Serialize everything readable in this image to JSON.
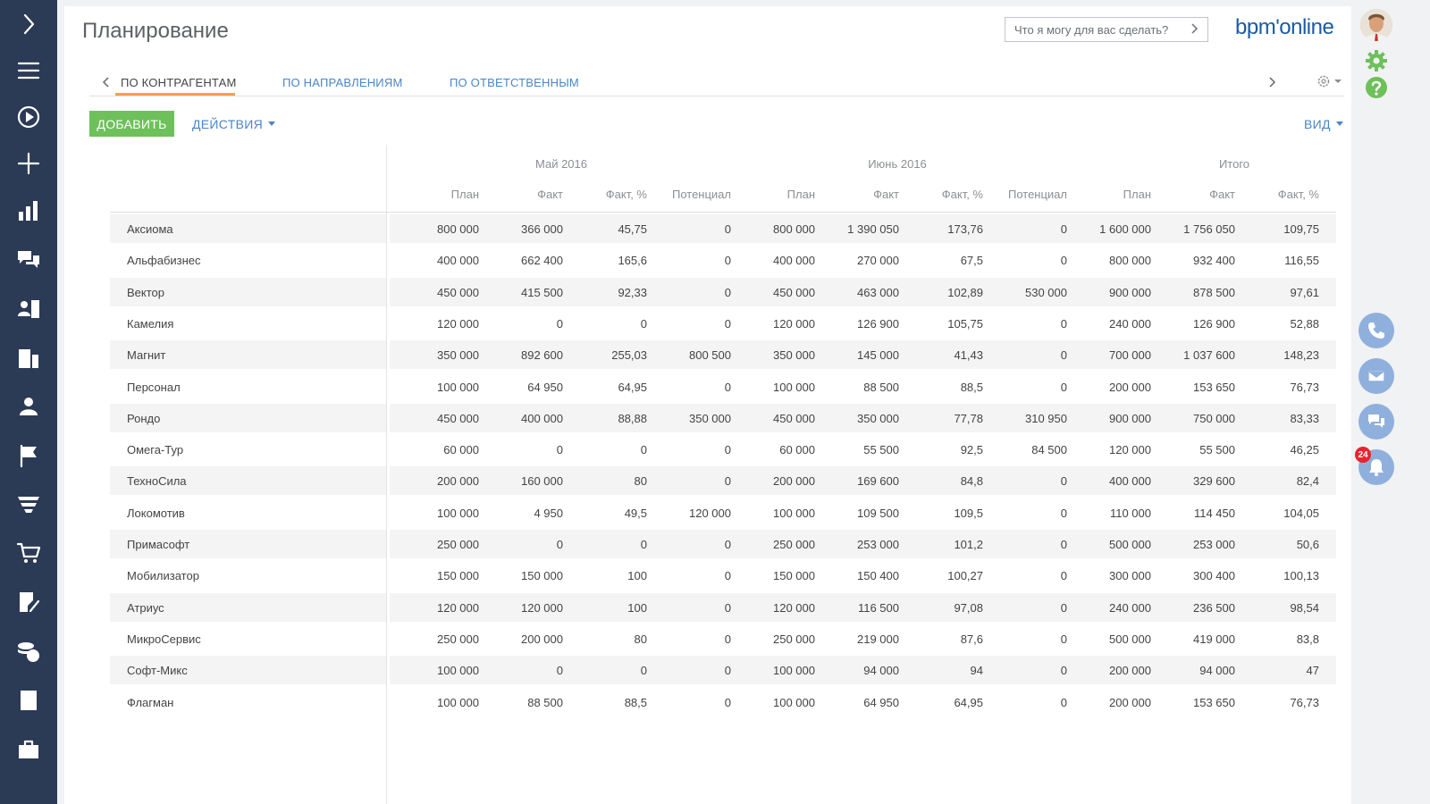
{
  "page": {
    "title": "Планирование",
    "search_placeholder": "Что я могу для вас сделать?",
    "logo_text": "bpm'online"
  },
  "tabs": [
    {
      "label": "ПО КОНТРАГЕНТАМ",
      "active": true
    },
    {
      "label": "ПО НАПРАВЛЕНИЯМ",
      "active": false
    },
    {
      "label": "ПО ОТВЕТСТВЕННЫМ",
      "active": false
    }
  ],
  "toolbar": {
    "add_label": "ДОБАВИТЬ",
    "actions_label": "ДЕЙСТВИЯ",
    "view_label": "ВИД"
  },
  "colors": {
    "sidebar": "#2b3a55",
    "accent_green": "#6ec05b",
    "link_blue": "#4a86c5",
    "tab_underline": "#f2a14e",
    "badge_red": "#e8242f"
  },
  "sidebar_icons": [
    "chevron-right-icon",
    "menu-icon",
    "play-icon",
    "plus-icon",
    "bar-chart-icon",
    "chat-icon",
    "contacts-icon",
    "building-icon",
    "person-icon",
    "flag-icon",
    "funnel-icon",
    "cart-icon",
    "document-edit-icon",
    "coins-icon",
    "document-icon",
    "briefcase-icon"
  ],
  "grid": {
    "periods": [
      "Май 2016",
      "Июнь 2016",
      "Итого"
    ],
    "columns": [
      "План",
      "Факт",
      "Факт, %",
      "Потенциал",
      "План",
      "Факт",
      "Факт, %",
      "Потенциал",
      "План",
      "Факт",
      "Факт, %"
    ],
    "rows": [
      {
        "name": "Аксиома",
        "values": [
          "800 000",
          "366 000",
          "45,75",
          "0",
          "800 000",
          "1 390 050",
          "173,76",
          "0",
          "1 600 000",
          "1 756 050",
          "109,75"
        ]
      },
      {
        "name": "Альфабизнес",
        "values": [
          "400 000",
          "662 400",
          "165,6",
          "0",
          "400 000",
          "270 000",
          "67,5",
          "0",
          "800 000",
          "932 400",
          "116,55"
        ]
      },
      {
        "name": "Вектор",
        "values": [
          "450 000",
          "415 500",
          "92,33",
          "0",
          "450 000",
          "463 000",
          "102,89",
          "530 000",
          "900 000",
          "878 500",
          "97,61"
        ]
      },
      {
        "name": "Камелия",
        "values": [
          "120 000",
          "0",
          "0",
          "0",
          "120 000",
          "126 900",
          "105,75",
          "0",
          "240 000",
          "126 900",
          "52,88"
        ]
      },
      {
        "name": "Магнит",
        "values": [
          "350 000",
          "892 600",
          "255,03",
          "800 500",
          "350 000",
          "145 000",
          "41,43",
          "0",
          "700 000",
          "1 037 600",
          "148,23"
        ]
      },
      {
        "name": "Персонал",
        "values": [
          "100 000",
          "64 950",
          "64,95",
          "0",
          "100 000",
          "88 500",
          "88,5",
          "0",
          "200 000",
          "153 650",
          "76,73"
        ]
      },
      {
        "name": "Рондо",
        "values": [
          "450 000",
          "400 000",
          "88,88",
          "350 000",
          "450 000",
          "350 000",
          "77,78",
          "310 950",
          "900 000",
          "750 000",
          "83,33"
        ]
      },
      {
        "name": "Омега-Тур",
        "values": [
          "60 000",
          "0",
          "0",
          "0",
          "60 000",
          "55 500",
          "92,5",
          "84 500",
          "120 000",
          "55 500",
          "46,25"
        ]
      },
      {
        "name": "ТехноСила",
        "values": [
          "200 000",
          "160 000",
          "80",
          "0",
          "200 000",
          "169 600",
          "84,8",
          "0",
          "400 000",
          "329 600",
          "82,4"
        ]
      },
      {
        "name": "Локомотив",
        "values": [
          "100 000",
          "4 950",
          "49,5",
          "120 000",
          "100 000",
          "109 500",
          "109,5",
          "0",
          "110 000",
          "114 450",
          "104,05"
        ]
      },
      {
        "name": "Примасофт",
        "values": [
          "250 000",
          "0",
          "0",
          "0",
          "250 000",
          "253 000",
          "101,2",
          "0",
          "500 000",
          "253 000",
          "50,6"
        ]
      },
      {
        "name": "Мобилизатор",
        "values": [
          "150 000",
          "150 000",
          "100",
          "0",
          "150 000",
          "150 400",
          "100,27",
          "0",
          "300 000",
          "300 400",
          "100,13"
        ]
      },
      {
        "name": "Атриус",
        "values": [
          "120 000",
          "120 000",
          "100",
          "0",
          "120 000",
          "116 500",
          "97,08",
          "0",
          "240 000",
          "236 500",
          "98,54"
        ]
      },
      {
        "name": "МикроСервис",
        "values": [
          "250 000",
          "200 000",
          "80",
          "0",
          "250 000",
          "219 000",
          "87,6",
          "0",
          "500 000",
          "419 000",
          "83,8"
        ]
      },
      {
        "name": "Софт-Микс",
        "values": [
          "100 000",
          "0",
          "0",
          "0",
          "100 000",
          "94 000",
          "94",
          "0",
          "200 000",
          "94 000",
          "47"
        ]
      },
      {
        "name": "Флагман",
        "values": [
          "100 000",
          "88 500",
          "88,5",
          "0",
          "100 000",
          "64 950",
          "64,95",
          "0",
          "200 000",
          "153 650",
          "76,73"
        ]
      }
    ]
  },
  "rightbar": {
    "notification_count": "24",
    "icons": [
      "avatar",
      "gear-icon",
      "help-icon",
      "phone-icon",
      "mail-icon",
      "chat-icon",
      "bell-icon"
    ]
  }
}
